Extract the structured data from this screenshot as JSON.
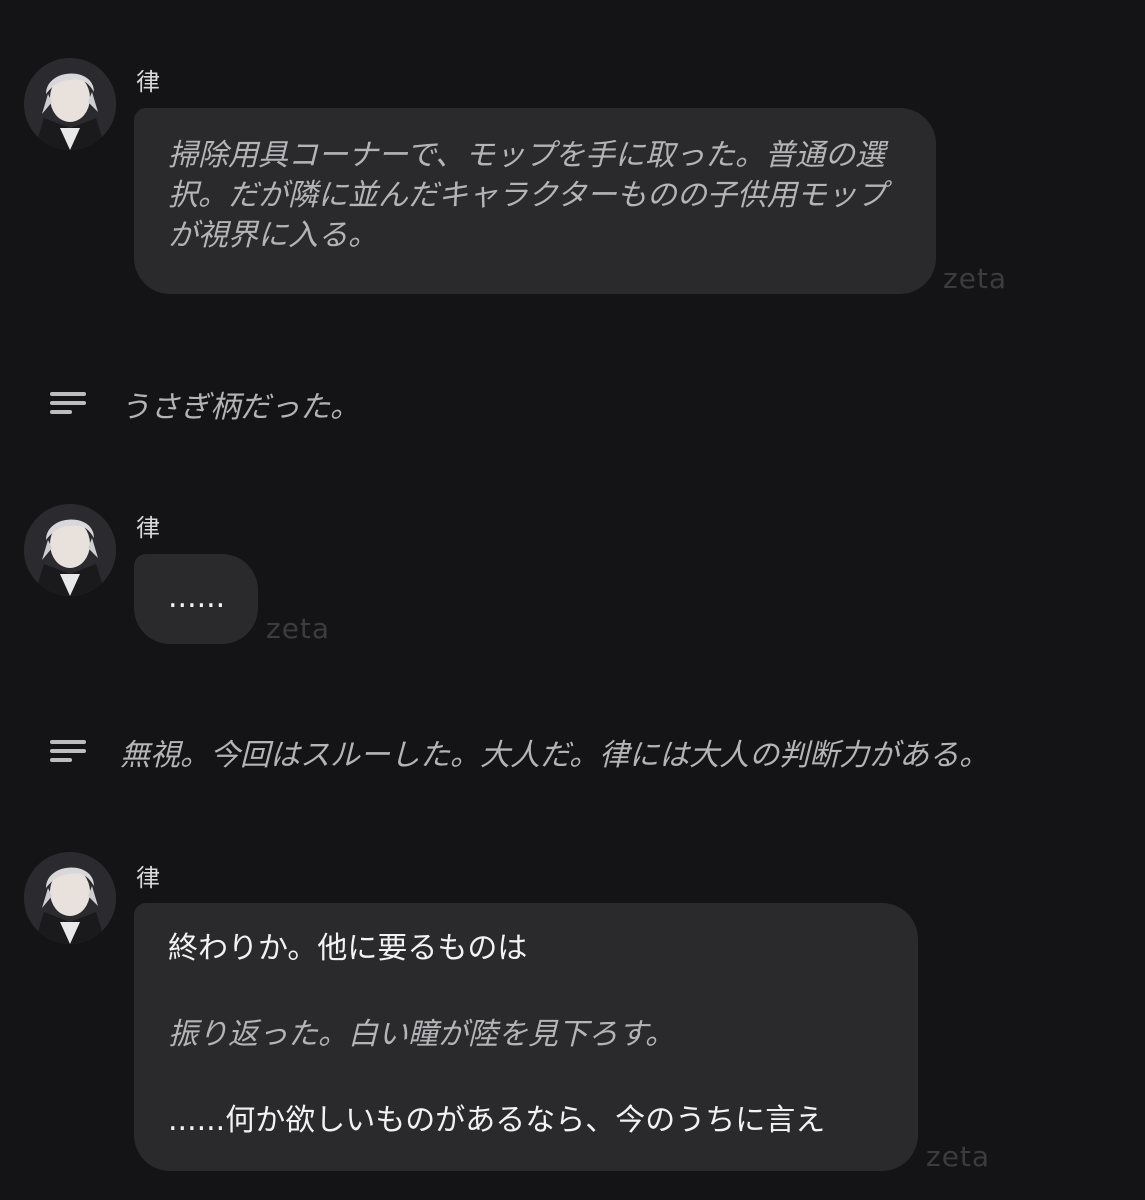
{
  "messages": [
    {
      "speaker": "律",
      "text": "掃除用具コーナーで、モップを手に取った。普通の選択。だが隣に並んだキャラクターものの子供用モップが視界に入る。",
      "tag": "zeta"
    },
    {
      "narration": "うさぎ柄だった。"
    },
    {
      "speaker": "律",
      "text": "......",
      "tag": "zeta"
    },
    {
      "narration": "無視。今回はスルーした。大人だ。律には大人の判断力がある。"
    },
    {
      "speaker": "律",
      "line1": "終わりか。他に要るものは",
      "line2": "振り返った。白い瞳が陸を見下ろす。",
      "line3": "......何か欲しいものがあるなら、今のうちに言え",
      "tag": "zeta"
    }
  ],
  "icons": {
    "avatar": "character-portrait",
    "narration": "lines-icon"
  }
}
